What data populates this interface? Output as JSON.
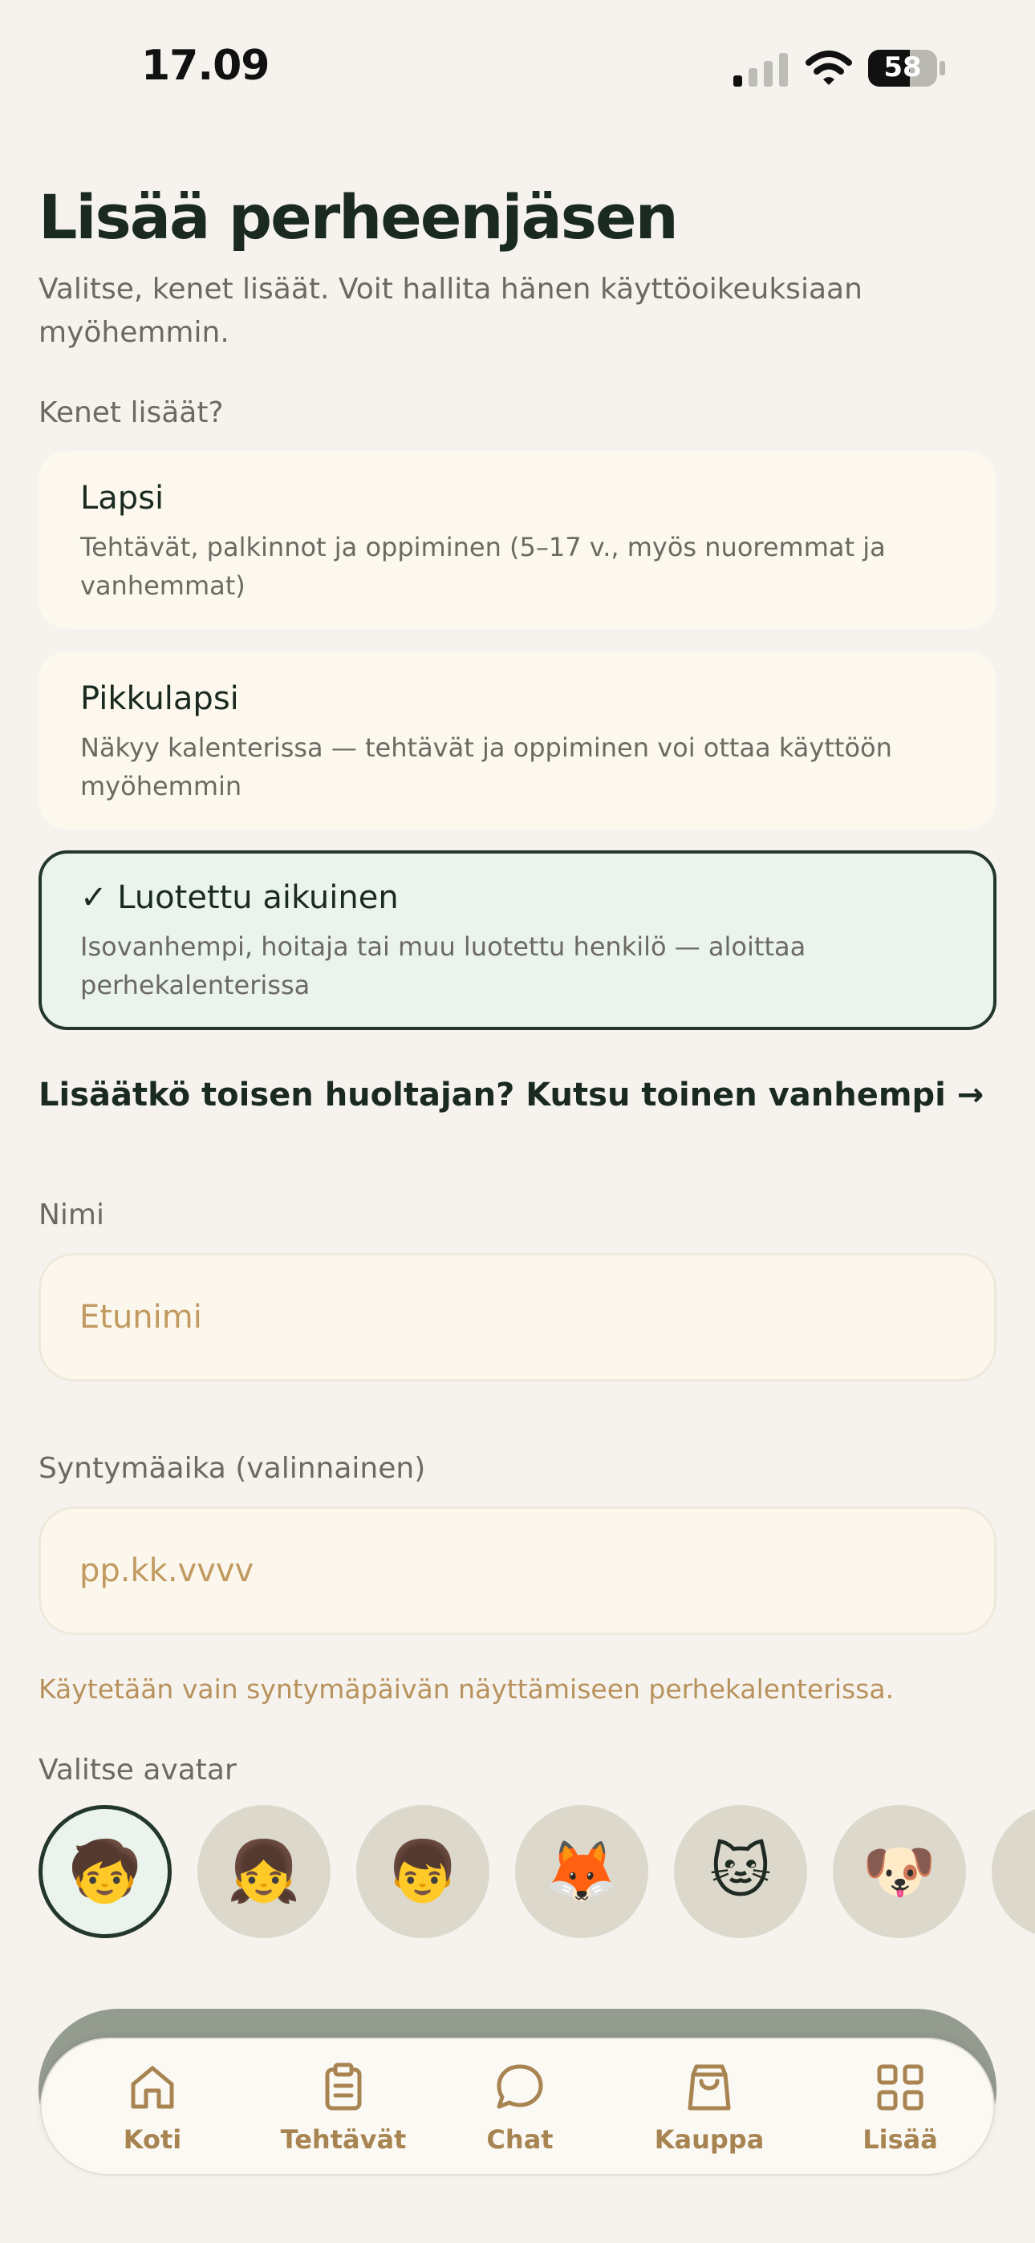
{
  "status": {
    "time": "17.09",
    "battery": "58"
  },
  "header": {
    "title": "Lisää perheenjäsen",
    "subtitle": "Valitse, kenet lisäät. Voit hallita hänen käyttöoikeuksiaan myöhemmin."
  },
  "who": {
    "label": "Kenet lisäät?",
    "options": [
      {
        "title": "Lapsi",
        "desc": "Tehtävät, palkinnot ja oppiminen (5–17 v., myös nuoremmat ja vanhemmat)"
      },
      {
        "title": "Pikkulapsi",
        "desc": "Näkyy kalenterissa — tehtävät ja oppiminen voi ottaa käyttöön myöhemmin"
      },
      {
        "title": "✓ Luotettu aikuinen",
        "desc": "Isovanhempi, hoitaja tai muu luotettu henkilö — aloittaa perhekalenterissa",
        "selected": true
      }
    ]
  },
  "invite_link": "Lisäätkö toisen huoltajan? Kutsu toinen vanhempi →",
  "name_field": {
    "label": "Nimi",
    "placeholder": "Etunimi"
  },
  "birth_field": {
    "label": "Syntymäaika (valinnainen)",
    "placeholder": "pp.kk.vvvv",
    "hint": "Käytetään vain syntymäpäivän näyttämiseen perhekalenterissa."
  },
  "avatar": {
    "label": "Valitse avatar",
    "options": [
      "🧒",
      "👧",
      "👦",
      "🦊",
      "🐱",
      "🐶"
    ],
    "selected_index": 0
  },
  "tabbar": {
    "items": [
      {
        "label": "Koti",
        "icon": "home-icon"
      },
      {
        "label": "Tehtävät",
        "icon": "clipboard-icon"
      },
      {
        "label": "Chat",
        "icon": "chat-bubble-icon"
      },
      {
        "label": "Kauppa",
        "icon": "shopping-bag-icon"
      },
      {
        "label": "Lisää",
        "icon": "grid-icon"
      }
    ]
  },
  "colors": {
    "accent": "#23382b",
    "tab": "#a88452",
    "background": "#f6f3ee"
  }
}
